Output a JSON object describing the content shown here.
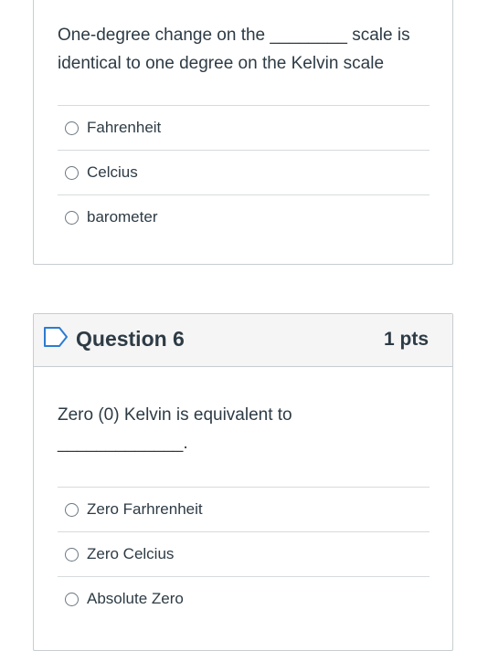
{
  "question5": {
    "text": "One-degree change on the ________ scale is identical to one degree on the Kelvin  scale",
    "answers": [
      {
        "label": "Fahrenheit"
      },
      {
        "label": "Celcius"
      },
      {
        "label": "barometer"
      }
    ]
  },
  "question6": {
    "title": "Question 6",
    "points": "1 pts",
    "bookmark_icon": "bookmark-flag-icon",
    "text_line1": "Zero (0) Kelvin  is equivalent to",
    "text_line2": "_____________.",
    "answers": [
      {
        "label": "Zero Farhrenheit"
      },
      {
        "label": "Zero Celcius"
      },
      {
        "label": "Absolute Zero"
      }
    ]
  },
  "colors": {
    "text": "#2d3b45",
    "border": "#c7cdd1",
    "header_bg": "#f5f5f5",
    "bookmark": "#2d7bd1"
  }
}
